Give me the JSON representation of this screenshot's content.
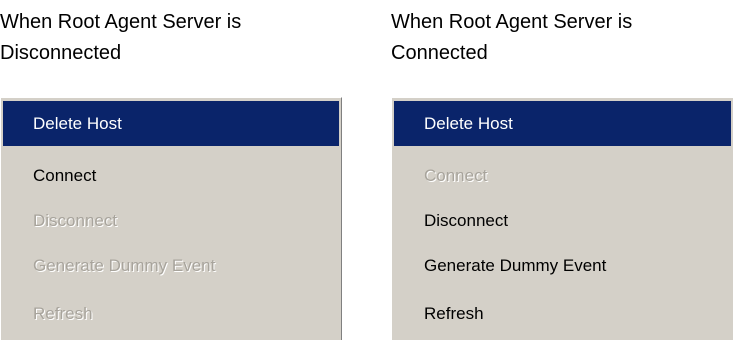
{
  "panels": [
    {
      "caption": "When Root Agent Server is\nDisconnected",
      "menu_items": [
        {
          "label": "Delete Host",
          "state": "selected"
        },
        {
          "label": "Connect",
          "state": "enabled"
        },
        {
          "label": "Disconnect",
          "state": "disabled"
        },
        {
          "label": "Generate Dummy Event",
          "state": "disabled"
        },
        {
          "label": "Refresh",
          "state": "disabled"
        }
      ]
    },
    {
      "caption": "When Root Agent Server is\nConnected",
      "menu_items": [
        {
          "label": "Delete Host",
          "state": "selected"
        },
        {
          "label": "Connect",
          "state": "disabled"
        },
        {
          "label": "Disconnect",
          "state": "enabled"
        },
        {
          "label": "Generate Dummy Event",
          "state": "enabled"
        },
        {
          "label": "Refresh",
          "state": "enabled"
        }
      ]
    }
  ],
  "colors": {
    "menu_background": "#d4d0c8",
    "selection_background": "#0a246a",
    "selection_text": "#ffffff",
    "disabled_text": "#a8a49c",
    "enabled_text": "#000000"
  }
}
